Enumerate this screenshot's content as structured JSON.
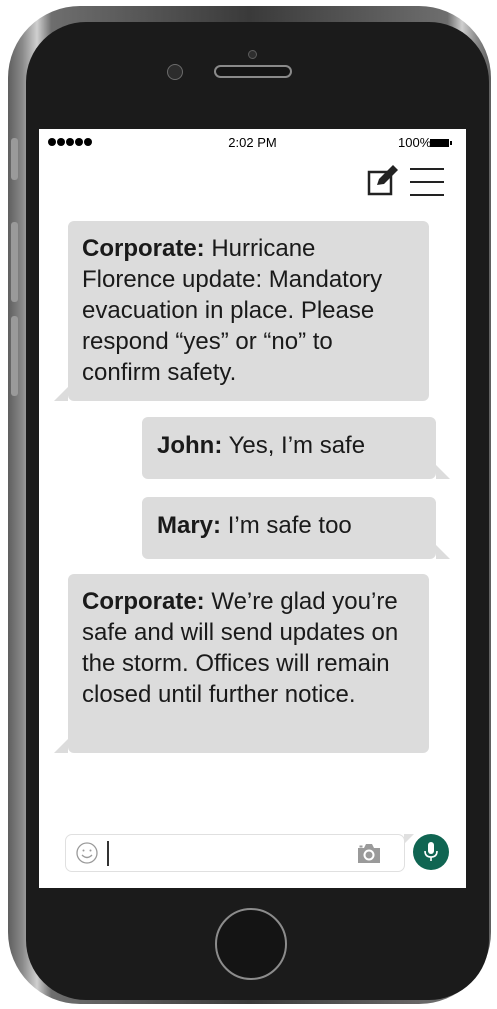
{
  "status_bar": {
    "time": "2:02 PM",
    "battery": "100%"
  },
  "header": {
    "compose_icon": "compose-icon",
    "menu_icon": "hamburger-menu-icon"
  },
  "messages": [
    {
      "sender": "Corporate:",
      "text": "Hurricane Florence update: Mandatory evacuation in place. Please respond “yes” or “no” to confirm safety.",
      "direction": "incoming"
    },
    {
      "sender": "John:",
      "text": "Yes, I’m safe",
      "direction": "outgoing"
    },
    {
      "sender": "Mary:",
      "text": "I’m safe too",
      "direction": "outgoing"
    },
    {
      "sender": "Corporate:",
      "text": "We’re glad you’re safe and will send updates on the storm. Offices will remain closed until further notice.",
      "direction": "incoming"
    }
  ],
  "composer": {
    "emoji_icon": "smiley-icon",
    "camera_icon": "camera-icon",
    "mic_icon": "microphone-icon"
  },
  "colors": {
    "bubble": "#dcdcdc",
    "mic_button": "#106552",
    "phone_body": "#1b1b1b"
  }
}
